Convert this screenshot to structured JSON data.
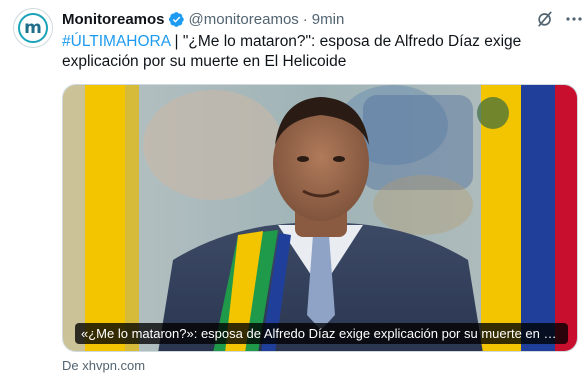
{
  "author": {
    "display_name": "Monitoreamos",
    "handle": "@monitoreamos",
    "separator": "·",
    "time": "9min",
    "avatar_letter": "m"
  },
  "tweet": {
    "hashtag": "#ÚLTIMAHORA",
    "text": " |  \"¿Me lo mataron?\": esposa de Alfredo Díaz exige explicación por su muerte en El Helicoide"
  },
  "card": {
    "title": "«¿Me lo mataron?»: esposa de Alfredo Díaz exige explicación por su muerte en El Helicoide",
    "source": "De xhvpn.com"
  },
  "icons": {
    "verified": "verified-badge-icon",
    "grok": "grok-icon",
    "more": "more-options-icon"
  },
  "colors": {
    "link_blue": "#1d9bf0",
    "secondary_text": "#536471",
    "flag_yellow": "#f2c500",
    "flag_blue": "#1f3f9a",
    "flag_red": "#c8102e",
    "sash_green": "#1f9a4a"
  }
}
